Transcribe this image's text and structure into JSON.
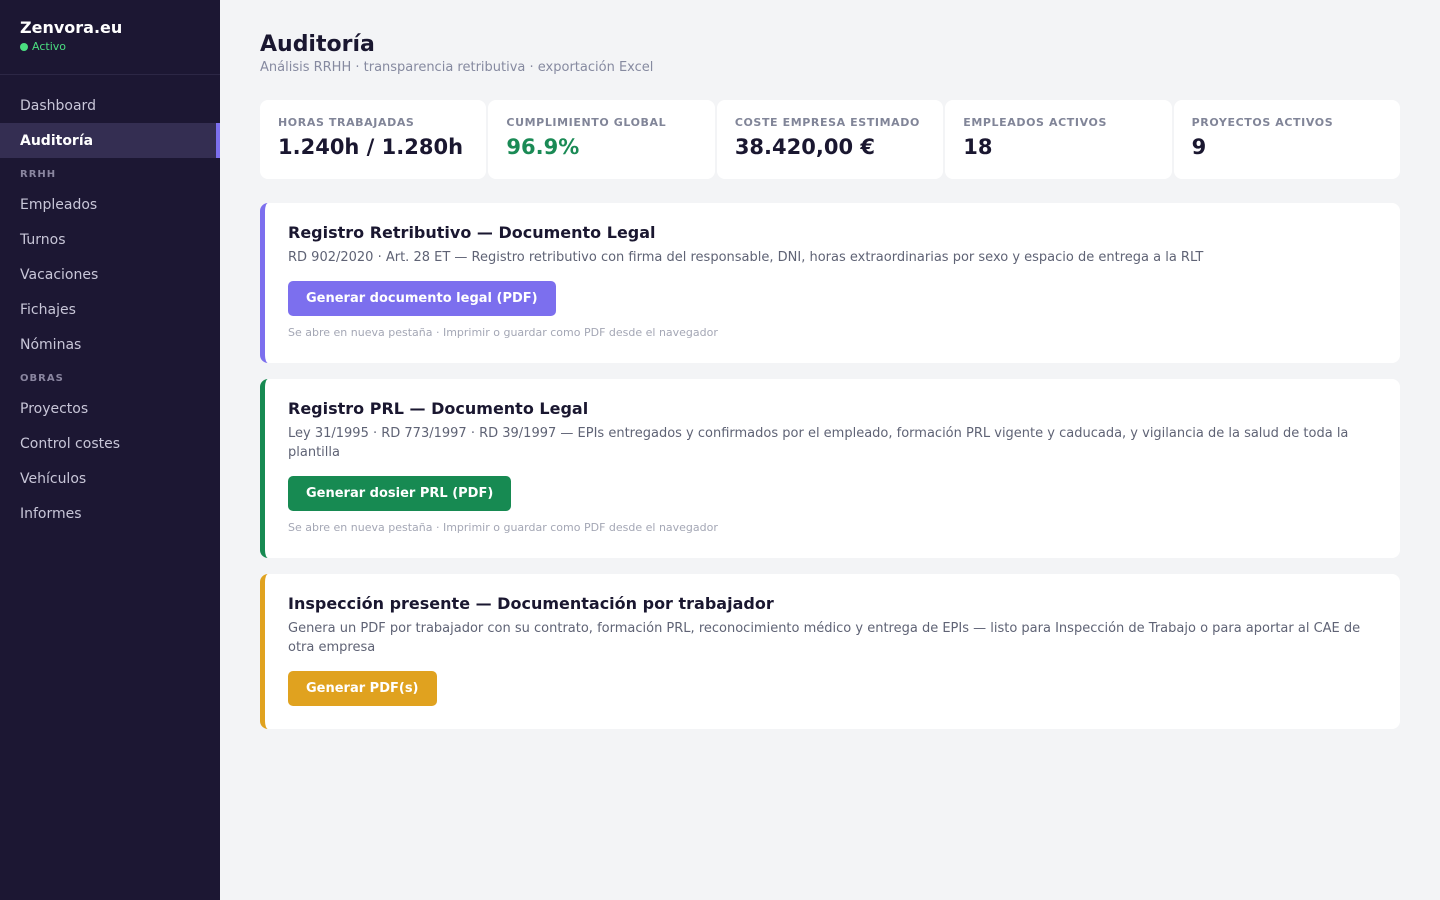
{
  "app": {
    "name": "Zenvora.eu",
    "status": "Activo",
    "status_color": "#4ade80",
    "accent": "#7c6fee"
  },
  "sidebar": {
    "items": [
      {
        "label": "Dashboard"
      },
      {
        "label": "Auditoría",
        "active": true
      },
      {
        "section": "RRHH"
      },
      {
        "label": "Empleados"
      },
      {
        "label": "Turnos"
      },
      {
        "label": "Vacaciones"
      },
      {
        "label": "Fichajes"
      },
      {
        "label": "Nóminas"
      },
      {
        "section": "OBRAS"
      },
      {
        "label": "Proyectos"
      },
      {
        "label": "Control costes"
      },
      {
        "label": "Vehículos"
      },
      {
        "label": "Informes"
      }
    ]
  },
  "header": {
    "title": "Auditoría",
    "subtitle": "Análisis RRHH · transparencia retributiva · exportación Excel"
  },
  "stats": [
    {
      "label": "HORAS TRABAJADAS",
      "value": "1.240h / 1.280h"
    },
    {
      "label": "CUMPLIMIENTO GLOBAL",
      "value": "96.9%",
      "color": "#1a8a55"
    },
    {
      "label": "COSTE EMPRESA ESTIMADO",
      "value": "38.420,00 €"
    },
    {
      "label": "EMPLEADOS ACTIVOS",
      "value": "18"
    },
    {
      "label": "PROYECTOS ACTIVOS",
      "value": "9"
    }
  ],
  "cards": [
    {
      "title": "Registro Retributivo — Documento Legal",
      "description": "RD 902/2020 · Art. 28 ET — Registro retributivo con firma del responsable, DNI, horas extraordinarias por sexo y espacio de entrega a la RLT",
      "button": "Generar documento legal (PDF)",
      "note": "Se abre en nueva pestaña · Imprimir o guardar como PDF desde el navegador",
      "color": "#7c6fee"
    },
    {
      "title": "Registro PRL — Documento Legal",
      "description": "Ley 31/1995 · RD 773/1997 · RD 39/1997 — EPIs entregados y confirmados por el empleado, formación PRL vigente y caducada, y vigilancia de la salud de toda la plantilla",
      "button": "Generar dosier PRL (PDF)",
      "note": "Se abre en nueva pestaña · Imprimir o guardar como PDF desde el navegador",
      "color": "#178a52"
    },
    {
      "title": "Inspección presente — Documentación por trabajador",
      "description": "Genera un PDF por trabajador con su contrato, formación PRL, reconocimiento médico y entrega de EPIs — listo para Inspección de Trabajo o para aportar al CAE de otra empresa",
      "button": "Generar PDF(s)",
      "color": "#e0a21f"
    }
  ]
}
